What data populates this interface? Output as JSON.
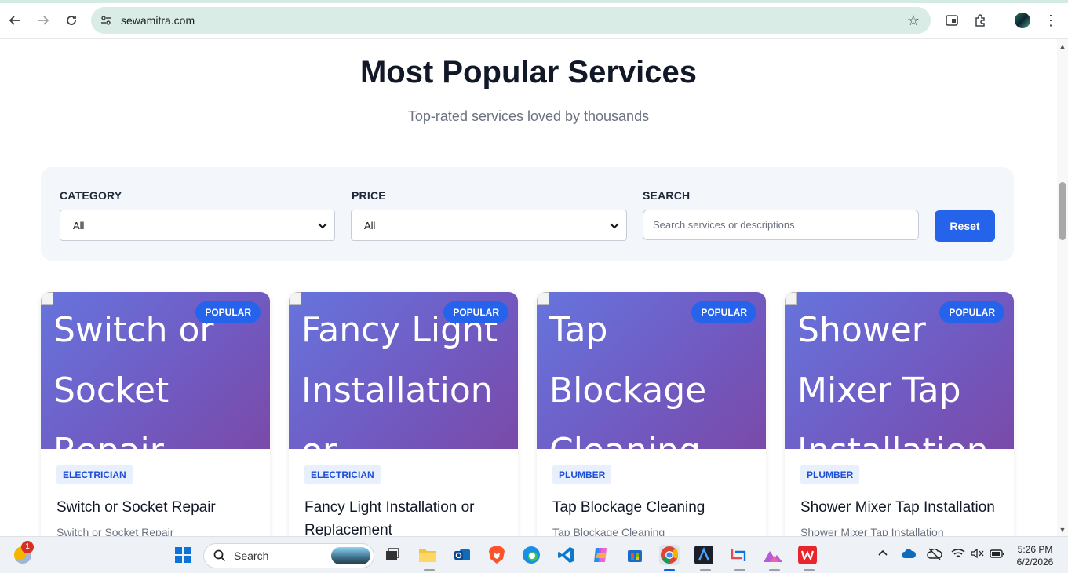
{
  "browser": {
    "url": "sewamitra.com"
  },
  "page": {
    "title": "Most Popular Services",
    "subtitle": "Top-rated services loved by thousands",
    "filters": {
      "category_label": "CATEGORY",
      "category_value": "All",
      "price_label": "PRICE",
      "price_value": "All",
      "search_label": "SEARCH",
      "search_placeholder": "Search services or descriptions",
      "reset_label": "Reset"
    },
    "cards": [
      {
        "image_alt": "Switch or Socket Repair",
        "badge": "POPULAR",
        "tag": "ELECTRICIAN",
        "title": "Switch or Socket Repair",
        "desc": "Switch or Socket Repair"
      },
      {
        "image_alt": "Fancy Light Installation or Replacement",
        "badge": "POPULAR",
        "tag": "ELECTRICIAN",
        "title": "Fancy Light Installation or Replacement",
        "desc": ""
      },
      {
        "image_alt": "Tap Blockage Cleaning",
        "badge": "POPULAR",
        "tag": "PLUMBER",
        "title": "Tap Blockage Cleaning",
        "desc": "Tap Blockage Cleaning"
      },
      {
        "image_alt": "Shower Mixer Tap Installation",
        "badge": "POPULAR",
        "tag": "PLUMBER",
        "title": "Shower Mixer Tap Installation",
        "desc": "Shower Mixer Tap Installation"
      }
    ]
  },
  "taskbar": {
    "search_label": "Search",
    "notification_count": "1",
    "time": "5:26 PM",
    "date": "6/2/2026"
  },
  "colors": {
    "accent": "#2563eb",
    "card_gradient_start": "#6674dd",
    "card_gradient_end": "#7a4aa8",
    "omnibox": "#d9ece5"
  }
}
